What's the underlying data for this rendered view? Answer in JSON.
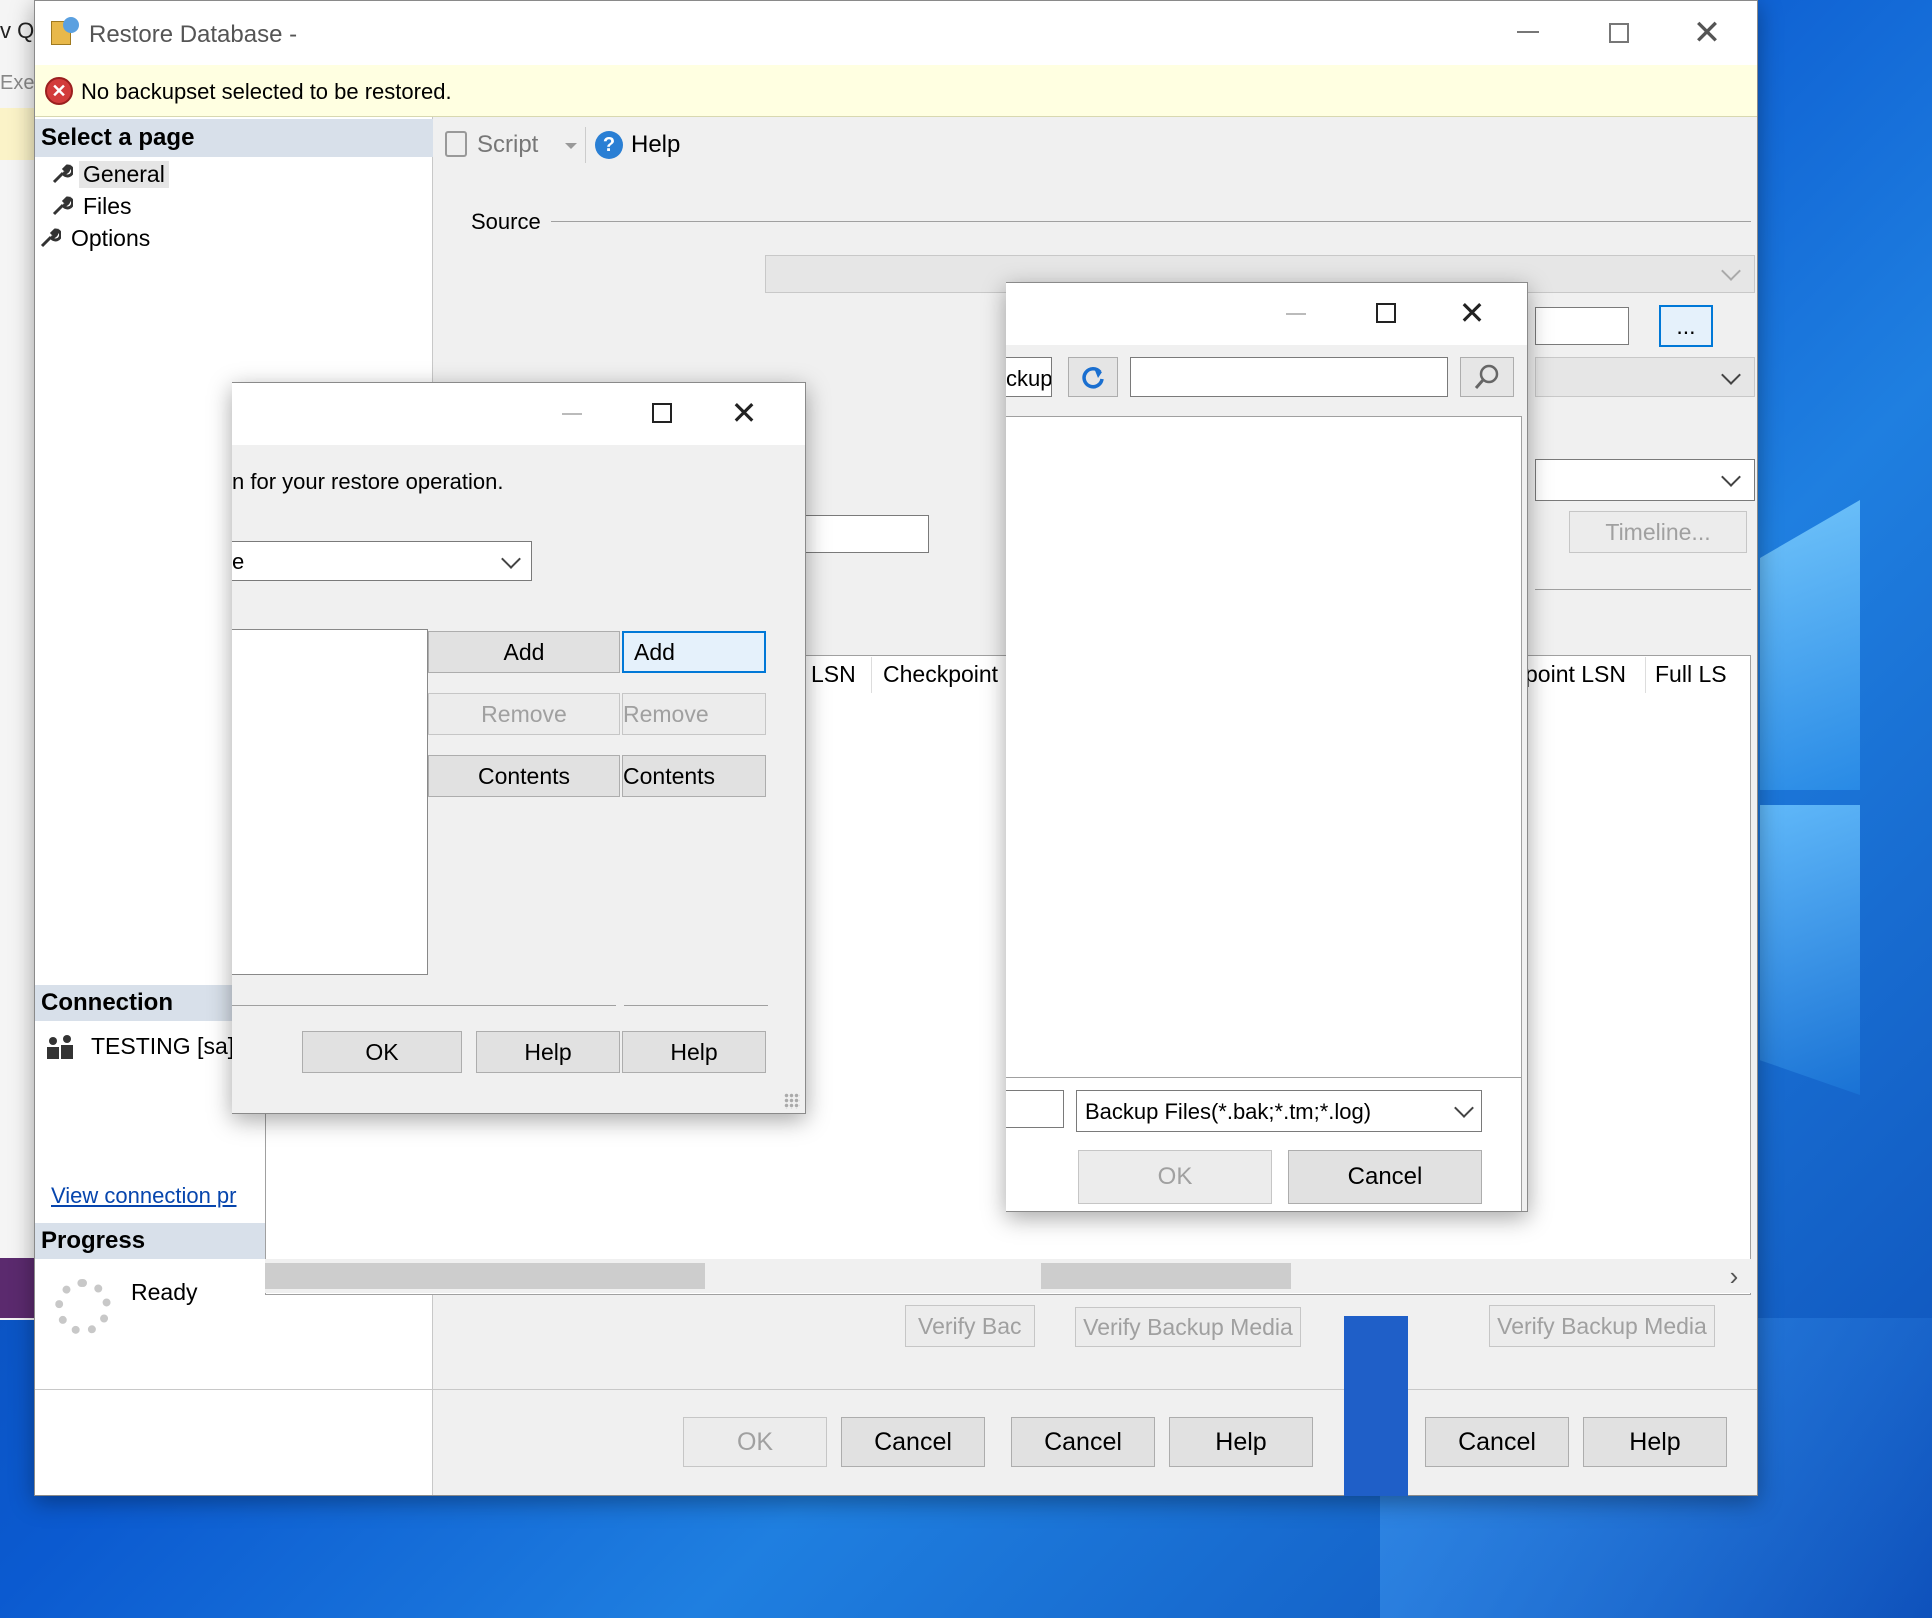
{
  "background_app": {
    "fragment_top": "v Qu",
    "fragment_exec": "Exec"
  },
  "main_window": {
    "title": "Restore Database -",
    "error_banner": "No backupset selected to be restored.",
    "left_panel": {
      "select_page_header": "Select a page",
      "pages": [
        "General",
        "Files",
        "Options"
      ],
      "connection_header": "Connection",
      "connection_value": "TESTING [sa]",
      "view_connection_link": "View connection pr",
      "progress_header": "Progress",
      "progress_status": "Ready"
    },
    "toolbar": {
      "script_label": "Script",
      "help_label": "Help"
    },
    "source_label": "Source",
    "timeline_button": "Timeline...",
    "grid_columns_left": [
      "LSN",
      "Checkpoint L"
    ],
    "grid_columns_right": [
      "point LSN",
      "Full LS"
    ],
    "verify_buttons": [
      "Verify Bac",
      "Verify Backup Media",
      "Verify Backup Media"
    ],
    "browse_button": "...",
    "footer_buttons": {
      "ok": "OK",
      "cancel_1": "Cancel",
      "cancel_2": "Cancel",
      "help_1": "Help",
      "cancel_3": "Cancel",
      "help_2": "Help"
    }
  },
  "select_backup_devices_dialog": {
    "instruction_fragment": "n for your restore operation.",
    "media_type_value": "e",
    "buttons": {
      "add_1": "Add",
      "add_2": "Add",
      "remove_1": "Remove",
      "remove_2": "Remove",
      "contents_1": "Contents",
      "contents_2": "Contents",
      "ok": "OK",
      "help_1": "Help",
      "help_2": "Help"
    }
  },
  "locate_backup_file_dialog": {
    "path_fragment": "ckup",
    "search_placeholder": "",
    "file_type_value": "Backup Files(*.bak;*.tm;*.log)",
    "buttons": {
      "ok": "OK",
      "cancel": "Cancel"
    }
  }
}
